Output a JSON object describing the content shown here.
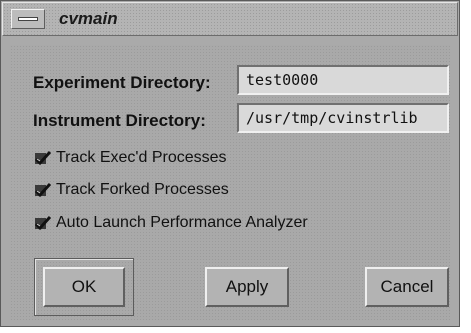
{
  "window": {
    "title": "cvmain"
  },
  "form": {
    "experiment_label": "Experiment Directory:",
    "experiment_value": "test0000",
    "instrument_label": "Instrument Directory:",
    "instrument_value": "/usr/tmp/cvinstrlib"
  },
  "options": [
    {
      "label": "Track Exec'd Processes",
      "checked": true
    },
    {
      "label": "Track Forked Processes",
      "checked": true
    },
    {
      "label": "Auto Launch Performance Analyzer",
      "checked": true
    }
  ],
  "buttons": {
    "ok": "OK",
    "apply": "Apply",
    "cancel": "Cancel"
  },
  "icons": {
    "window_menu": "window-menu-icon",
    "checkmark": "checkmark-icon"
  }
}
